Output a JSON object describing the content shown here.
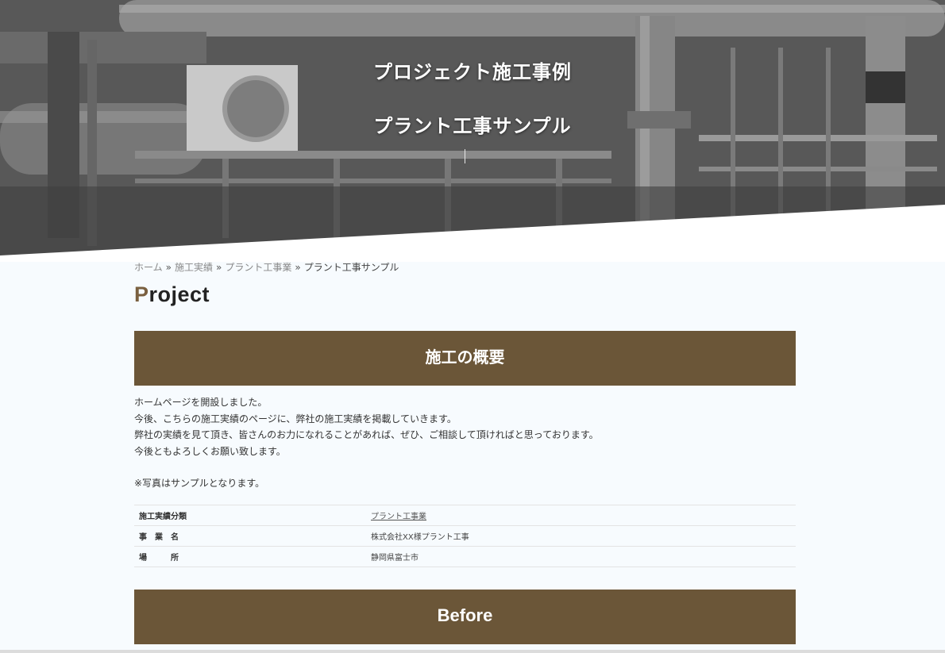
{
  "hero": {
    "title": "プロジェクト施工事例",
    "subtitle": "プラント工事サンプル"
  },
  "breadcrumb": {
    "items": [
      {
        "label": "ホーム"
      },
      {
        "label": "施工実績"
      },
      {
        "label": "プラント工事業"
      },
      {
        "label": "プラント工事サンプル"
      }
    ],
    "separator": "»"
  },
  "section": {
    "heading_first": "P",
    "heading_rest": "roject"
  },
  "overview": {
    "heading": "施工の概要",
    "paragraphs": [
      "ホームページを開設しました。",
      "今後、こちらの施工実績のページに、弊社の施工実績を掲載していきます。",
      "弊社の実績を見て頂き、皆さんのお力になれることがあれば、ぜひ、ご相談して頂ければと思っております。",
      "今後ともよろしくお願い致します。"
    ],
    "note": "※写真はサンプルとなります。"
  },
  "info_table": {
    "rows": [
      {
        "label": "施工実績分類",
        "value": "プラント工事業"
      },
      {
        "label": "事　業　名",
        "value": "株式会社XX様プラント工事"
      },
      {
        "label": "場　　　所",
        "value": "静岡県富士市"
      }
    ]
  },
  "before": {
    "heading": "Before"
  },
  "colors": {
    "band": "#6b5638",
    "accent_letter": "#7a6040",
    "page_bg": "#f7fbfe"
  }
}
